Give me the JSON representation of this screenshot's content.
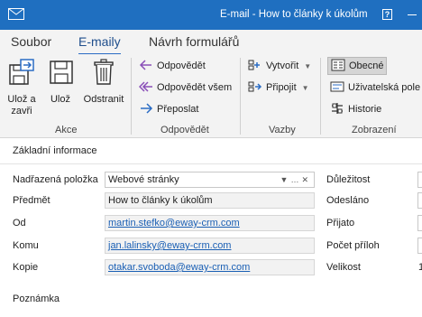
{
  "window": {
    "title": "E-mail - How to články k úkolům",
    "help": "?"
  },
  "tabs": [
    {
      "label": "Soubor"
    },
    {
      "label": "E-maily"
    },
    {
      "label": "Návrh formulářů"
    }
  ],
  "ribbon": {
    "akce": {
      "uloz_a_zavri": "Ulož a zavři",
      "uloz": "Ulož",
      "odstranit": "Odstranit",
      "group": "Akce"
    },
    "odpovedet": {
      "odpovedet": "Odpovědět",
      "odpovedet_vsem": "Odpovědět všem",
      "preposlat": "Přeposlat",
      "group": "Odpovědět"
    },
    "vazby": {
      "vytvorit": "Vytvořit",
      "pripojit": "Připojit",
      "group": "Vazby"
    },
    "zobrazeni": {
      "obecne": "Obecné",
      "uzivatelska_pole": "Uživatelská pole",
      "historie": "Historie",
      "group": "Zobrazení"
    }
  },
  "form": {
    "section": "Základní informace",
    "nadrazena": {
      "label": "Nadřazená položka",
      "value": "Webové stránky"
    },
    "predmet": {
      "label": "Předmět",
      "value": "How to články k úkolům"
    },
    "od": {
      "label": "Od",
      "value": "martin.stefko@eway-crm.com"
    },
    "komu": {
      "label": "Komu",
      "value": "jan.lalinsky@eway-crm.com"
    },
    "kopie": {
      "label": "Kopie",
      "value": "otakar.svoboda@eway-crm.com"
    },
    "poznamka": {
      "label": "Poznámka"
    },
    "right": {
      "dulezitost": "Důležitost",
      "odeslano": "Odesláno",
      "prijato": "Přijato",
      "pocet_priloh": "Počet příloh",
      "velikost": "Velikost",
      "velikost_value": "1"
    }
  },
  "colors": {
    "accent": "#1f6fc0",
    "link": "#1a5fb4"
  }
}
